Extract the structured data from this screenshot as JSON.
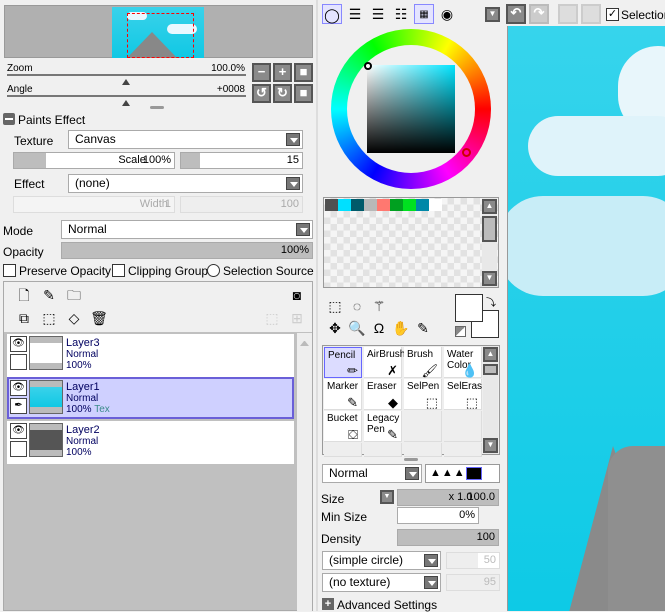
{
  "navigator": {
    "zoom_label": "Zoom",
    "zoom_value": "100.0%",
    "angle_label": "Angle",
    "angle_value": "+0008"
  },
  "paints_effect": {
    "title": "Paints Effect",
    "texture_label": "Texture",
    "texture_value": "Canvas",
    "scale_label": "Scale",
    "scale_value": "100%",
    "scale_strength": "15",
    "effect_label": "Effect",
    "effect_value": "(none)",
    "width_label": "Width",
    "width_value": "1",
    "width_strength": "100"
  },
  "layer_props": {
    "mode_label": "Mode",
    "mode_value": "Normal",
    "opacity_label": "Opacity",
    "opacity_value": "100%",
    "preserve_opacity": "Preserve Opacity",
    "clipping_group": "Clipping Group",
    "selection_source": "Selection Source"
  },
  "layers": [
    {
      "name": "Layer3",
      "mode": "Normal",
      "opacity": "100%",
      "extra": ""
    },
    {
      "name": "Layer1",
      "mode": "Normal",
      "opacity": "100%",
      "extra": "Tex"
    },
    {
      "name": "Layer2",
      "mode": "Normal",
      "opacity": "100%",
      "extra": ""
    }
  ],
  "swatches": [
    "#505050",
    "#00e0ff",
    "#005a6a",
    "#b8b8b8",
    "#ff7870",
    "#00a020",
    "#00e020",
    "#0088a8",
    "#ffffff"
  ],
  "tools": [
    {
      "label": "Pencil",
      "icon": "pencil-icon"
    },
    {
      "label": "AirBrush",
      "icon": "airbrush-icon"
    },
    {
      "label": "Brush",
      "icon": "brush-icon"
    },
    {
      "label": "Water Color",
      "icon": "watercolor-icon"
    },
    {
      "label": "Marker",
      "icon": "marker-icon"
    },
    {
      "label": "Eraser",
      "icon": "eraser-icon"
    },
    {
      "label": "SelPen",
      "icon": "selpen-icon"
    },
    {
      "label": "SelEras",
      "icon": "seleras-icon"
    },
    {
      "label": "Bucket",
      "icon": "bucket-icon"
    },
    {
      "label": "Legacy Pen",
      "icon": "legacy-pen-icon"
    }
  ],
  "brush": {
    "blend_mode": "Normal",
    "size_label": "Size",
    "size_mult": "x 1.0",
    "size_value": "100.0",
    "min_size_label": "Min Size",
    "min_size_value": "0%",
    "density_label": "Density",
    "density_value": "100",
    "shape": "(simple circle)",
    "shape_value": "50",
    "texture": "(no texture)",
    "texture_value": "95",
    "advanced": "Advanced Settings"
  },
  "toolbar": {
    "selection_label": "Selection"
  },
  "colors": {
    "selected_layer": "#cfd0ff",
    "selected_border": "#6a5fd8",
    "canvas_sky": "#2ad4ec"
  }
}
